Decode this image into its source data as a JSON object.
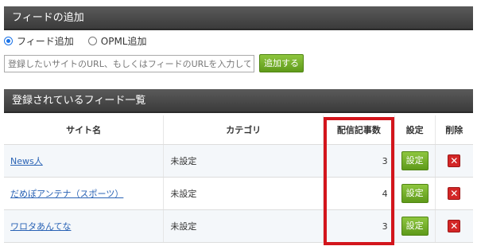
{
  "add_section": {
    "title": "フィードの追加",
    "radio_options": [
      {
        "label": "フィード追加",
        "checked": true
      },
      {
        "label": "OPML追加",
        "checked": false
      }
    ],
    "input_placeholder": "登録したいサイトのURL、もしくはフィードのURLを入力してくだ",
    "add_button_label": "追加する"
  },
  "list_section": {
    "title": "登録されているフィード一覧",
    "columns": [
      "サイト名",
      "カテゴリ",
      "配信記事数",
      "設定",
      "削除"
    ],
    "rows": [
      {
        "site": "News人",
        "category": "未設定",
        "count": "3",
        "setting_label": "設定"
      },
      {
        "site": "だめぽアンテナ（スポーツ）",
        "category": "未設定",
        "count": "4",
        "setting_label": "設定"
      },
      {
        "site": "ワロタあんてな",
        "category": "未設定",
        "count": "3",
        "setting_label": "設定"
      }
    ],
    "delete_icon": "close-icon"
  },
  "colors": {
    "header_bg": "#444444",
    "button_green": "#6fae24",
    "delete_red": "#d32626",
    "highlight_red": "#d3151c",
    "link_blue": "#2a63b5"
  }
}
